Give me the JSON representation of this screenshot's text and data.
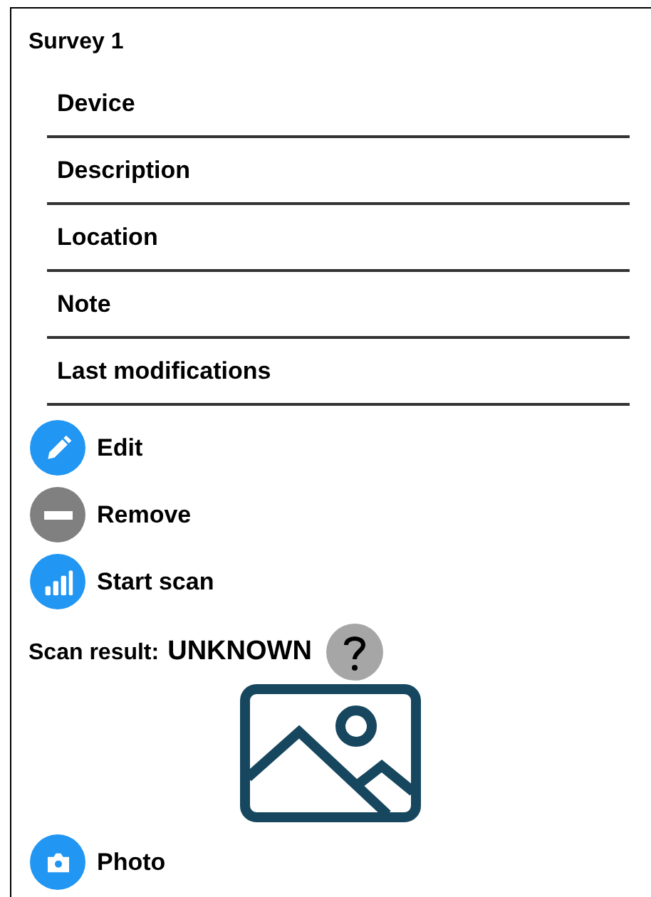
{
  "title": "Survey 1",
  "fields": [
    {
      "label": "Device"
    },
    {
      "label": "Description"
    },
    {
      "label": "Location"
    },
    {
      "label": "Note"
    },
    {
      "label": "Last modifications"
    }
  ],
  "actions": [
    {
      "kind": "edit",
      "label": "Edit",
      "disabled": false
    },
    {
      "kind": "remove",
      "label": "Remove",
      "disabled": true
    },
    {
      "kind": "scan",
      "label": "Start scan",
      "disabled": false
    }
  ],
  "scan_result": {
    "label": "Scan result:",
    "value": "UNKNOWN"
  },
  "photo_action": {
    "kind": "photo",
    "label": "Photo",
    "disabled": false
  }
}
